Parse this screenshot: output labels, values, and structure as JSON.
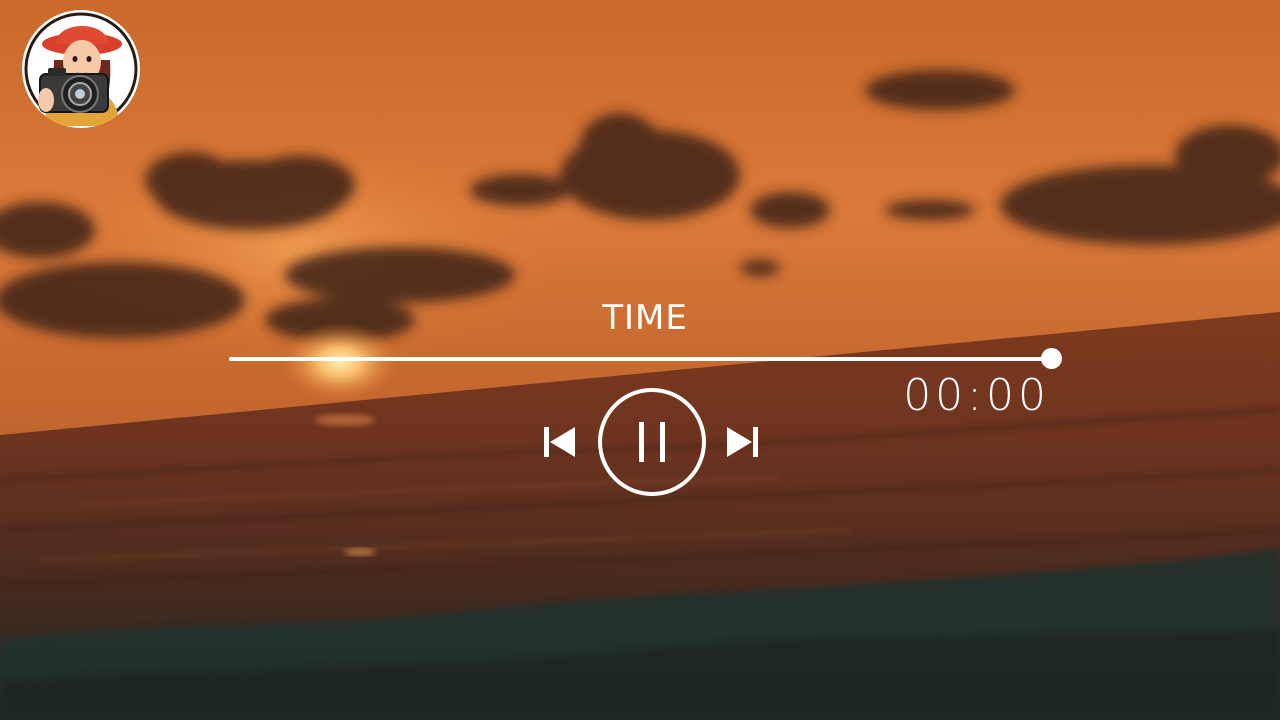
{
  "player": {
    "title": "TIME",
    "time": "00:00",
    "progress_fraction": 1.0
  },
  "controls": {
    "prev_icon": "skip-previous-icon",
    "pause_icon": "pause-icon",
    "next_icon": "skip-next-icon"
  },
  "channel": {
    "avatar_icon": "photographer-avatar-icon"
  },
  "colors": {
    "control_white": "#ffffff",
    "sky_orange": "#e07a30",
    "sea_dark": "#2e2a22"
  }
}
